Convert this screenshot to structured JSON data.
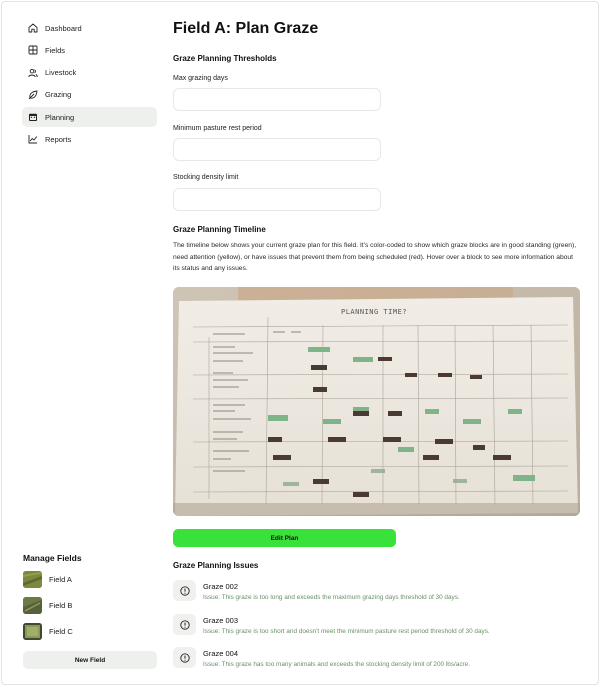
{
  "sidebar": {
    "nav": [
      {
        "label": "Dashboard",
        "icon": "home-icon"
      },
      {
        "label": "Fields",
        "icon": "grid-icon"
      },
      {
        "label": "Livestock",
        "icon": "users-icon"
      },
      {
        "label": "Grazing",
        "icon": "leaf-icon"
      },
      {
        "label": "Planning",
        "icon": "calendar-icon",
        "active": true
      },
      {
        "label": "Reports",
        "icon": "chart-line-icon"
      }
    ],
    "manage_title": "Manage Fields",
    "fields": [
      {
        "label": "Field A"
      },
      {
        "label": "Field B"
      },
      {
        "label": "Field C"
      }
    ],
    "new_field_label": "New Field"
  },
  "main": {
    "title": "Field A: Plan Graze",
    "thresholds": {
      "title": "Graze Planning Thresholds",
      "max_days_label": "Max grazing days",
      "max_days_value": "",
      "rest_label": "Minimum pasture rest period",
      "rest_value": "",
      "density_label": "Stocking density limit",
      "density_value": ""
    },
    "timeline": {
      "title": "Graze Planning Timeline",
      "description": "The timeline below shows your current graze plan for this field. It's color-coded to show which graze blocks are in good standing (green), need attention (yellow), or have issues that prevent them from being scheduled (red). Hover over a block to see more information about its status and any issues.",
      "image_heading": "PLANNING TIME?"
    },
    "edit_plan_label": "Edit Plan",
    "issues": {
      "title": "Graze Planning Issues",
      "items": [
        {
          "name": "Graze 002",
          "text": "Issue: This graze is too long and exceeds the maximum grazing days threshold of 30 days."
        },
        {
          "name": "Graze 003",
          "text": "Issue: This graze is too short and doesn't meet the minimum pasture rest period threshold of 30 days."
        },
        {
          "name": "Graze 004",
          "text": "Issue: This graze has too many animals and exceeds the stocking density limit of 200 lbs/acre."
        }
      ]
    }
  },
  "colors": {
    "accent_green": "#39e23a",
    "active_nav_bg": "#eef0ed",
    "issue_text": "#6a8f6a"
  }
}
